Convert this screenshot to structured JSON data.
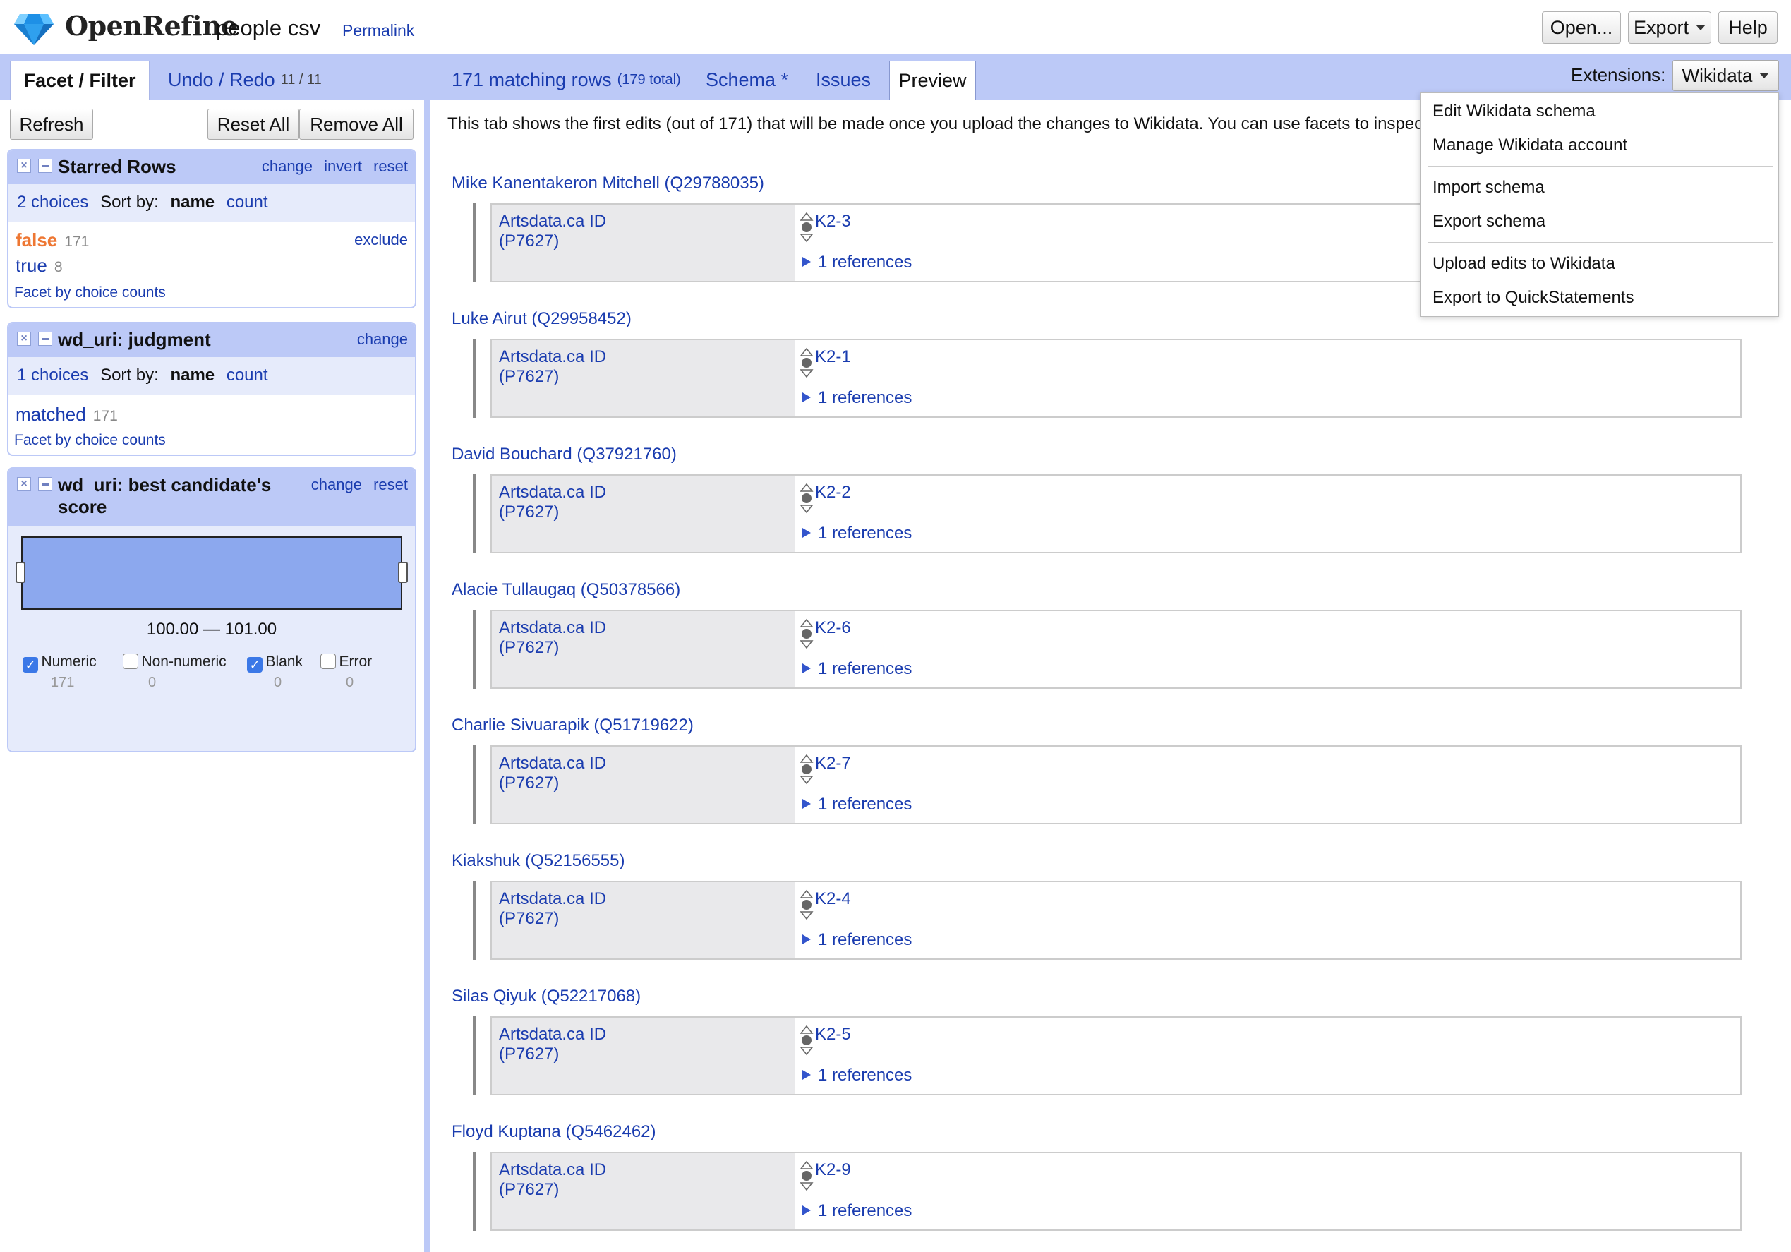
{
  "header": {
    "app_name": "OpenRefine",
    "project_name": "people csv",
    "permalink": "Permalink",
    "buttons": {
      "open": "Open...",
      "export": "Export",
      "help": "Help"
    }
  },
  "left_panel": {
    "tabs": {
      "facet": "Facet / Filter",
      "undo": "Undo / Redo",
      "undo_count": "11 / 11"
    },
    "buttons": {
      "refresh": "Refresh",
      "reset_all": "Reset All",
      "remove_all": "Remove All"
    },
    "facets": [
      {
        "title": "Starred Rows",
        "actions": [
          "change",
          "invert",
          "reset"
        ],
        "choices_label": "2 choices",
        "sort_by": "Sort by:",
        "sort_name": "name",
        "sort_count": "count",
        "choices": [
          {
            "label": "false",
            "count": "171",
            "color": "#ee7733"
          },
          {
            "label": "true",
            "count": "8",
            "color": "#1a3caf"
          }
        ],
        "exclude": "exclude",
        "footer": "Facet by choice counts"
      },
      {
        "title": "wd_uri: judgment",
        "actions": [
          "change"
        ],
        "choices_label": "1 choices",
        "sort_by": "Sort by:",
        "sort_name": "name",
        "sort_count": "count",
        "choices": [
          {
            "label": "matched",
            "count": "171"
          }
        ],
        "footer": "Facet by choice counts"
      },
      {
        "title": "wd_uri: best candidate's",
        "title_line2": "score",
        "actions": [
          "change",
          "reset"
        ],
        "range_label": "100.00 — 101.00",
        "range_fill_fraction": 1.0,
        "checks": [
          {
            "label": "Numeric",
            "checked": true,
            "count": "171"
          },
          {
            "label": "Non-numeric",
            "checked": false,
            "count": "0"
          },
          {
            "label": "Blank",
            "checked": true,
            "count": "0"
          },
          {
            "label": "Error",
            "checked": false,
            "count": "0"
          }
        ]
      }
    ]
  },
  "right_panel": {
    "tabs": {
      "rows": "171 matching rows",
      "rows_total": "(179 total)",
      "schema": "Schema *",
      "issues": "Issues",
      "preview": "Preview"
    },
    "extensions_label": "Extensions:",
    "extensions_button": "Wikidata",
    "preview_note": "This tab shows the first edits (out of 171) that will be made once you upload the changes to Wikidata. You can use facets to inspect",
    "items": [
      {
        "title": "Mike Kanentakeron Mitchell (Q29788035)",
        "prop": "Artsdata.ca ID",
        "pid": "(P7627)",
        "value": "K2-3",
        "refs": "1 references"
      },
      {
        "title": "Luke Airut (Q29958452)",
        "prop": "Artsdata.ca ID",
        "pid": "(P7627)",
        "value": "K2-1",
        "refs": "1 references"
      },
      {
        "title": "David Bouchard (Q37921760)",
        "prop": "Artsdata.ca ID",
        "pid": "(P7627)",
        "value": "K2-2",
        "refs": "1 references"
      },
      {
        "title": "Alacie Tullaugaq (Q50378566)",
        "prop": "Artsdata.ca ID",
        "pid": "(P7627)",
        "value": "K2-6",
        "refs": "1 references"
      },
      {
        "title": "Charlie Sivuarapik (Q51719622)",
        "prop": "Artsdata.ca ID",
        "pid": "(P7627)",
        "value": "K2-7",
        "refs": "1 references"
      },
      {
        "title": "Kiakshuk (Q52156555)",
        "prop": "Artsdata.ca ID",
        "pid": "(P7627)",
        "value": "K2-4",
        "refs": "1 references"
      },
      {
        "title": "Silas Qiyuk (Q52217068)",
        "prop": "Artsdata.ca ID",
        "pid": "(P7627)",
        "value": "K2-5",
        "refs": "1 references"
      },
      {
        "title": "Floyd Kuptana (Q5462462)",
        "prop": "Artsdata.ca ID",
        "pid": "(P7627)",
        "value": "K2-9",
        "refs": "1 references"
      }
    ]
  },
  "extensions_menu": {
    "items": [
      "Edit Wikidata schema",
      "Manage Wikidata account",
      "Import schema",
      "Export schema",
      "Upload edits to Wikidata",
      "Export to QuickStatements"
    ]
  },
  "colors": {
    "accent": "#bcc9f7",
    "link": "#1a3caf",
    "false_choice": "#ee7733",
    "range_bar": "#8ca8ee"
  }
}
